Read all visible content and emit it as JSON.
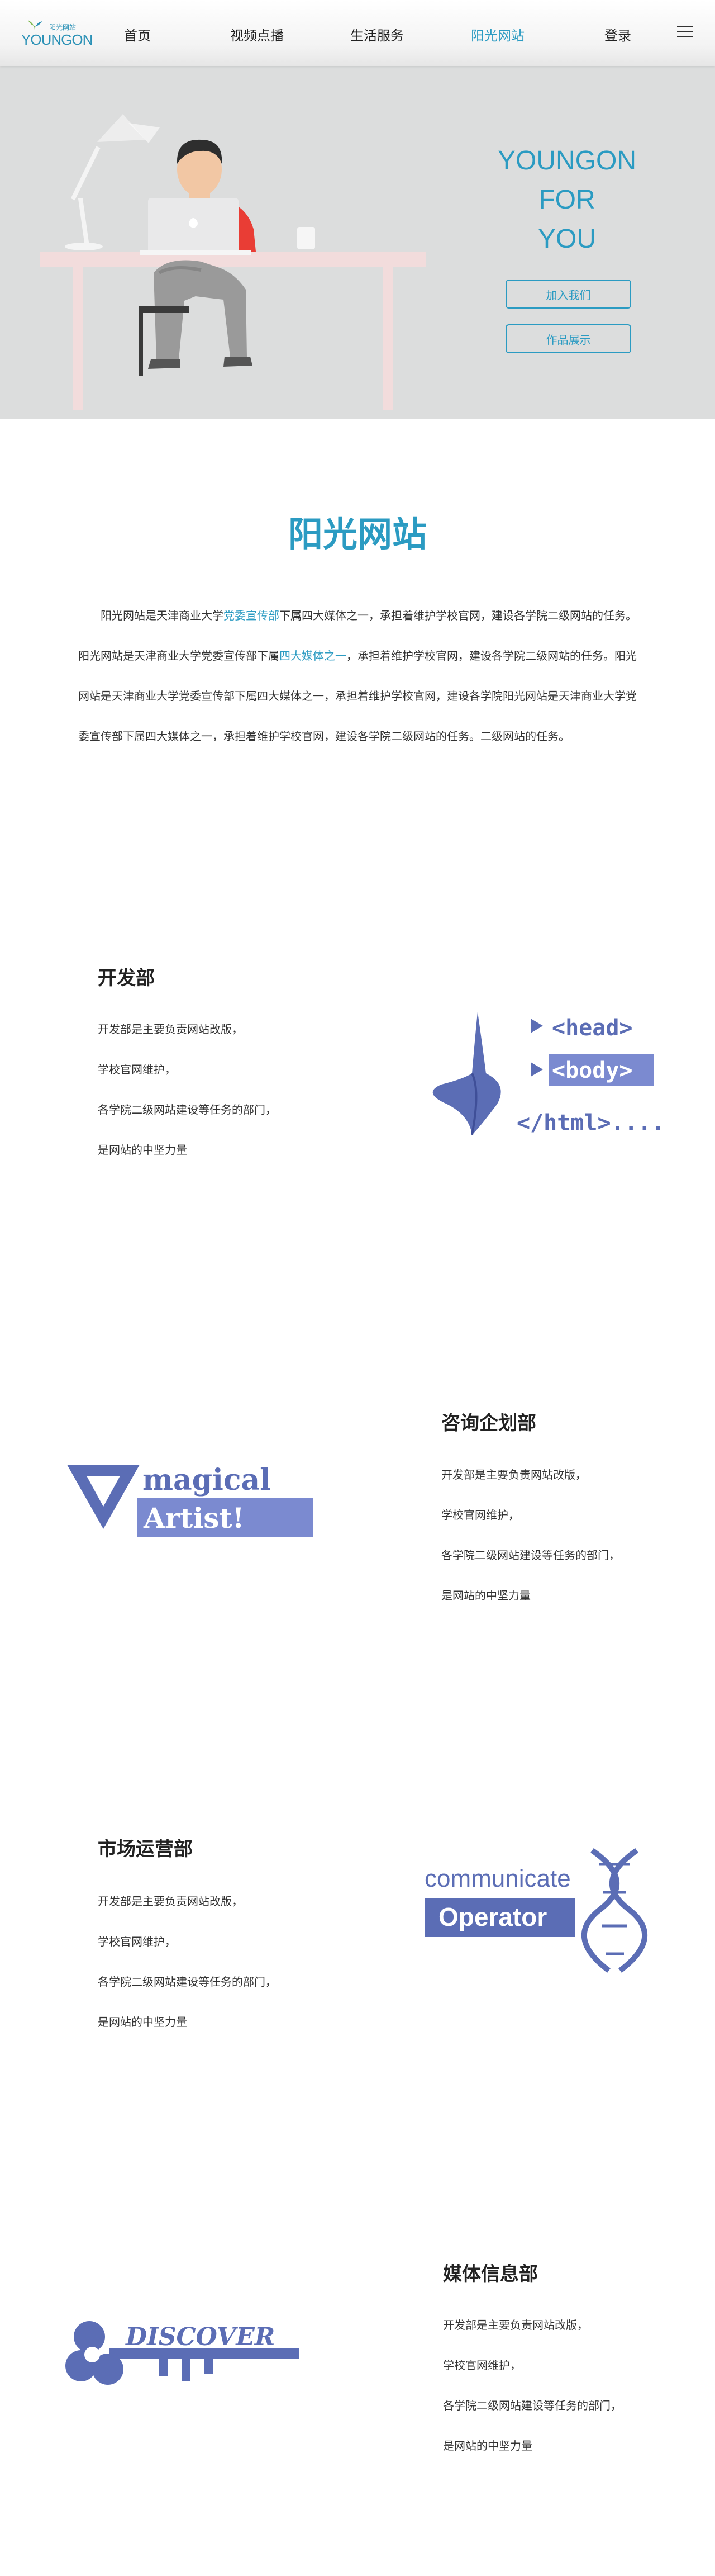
{
  "nav": {
    "logo_cn": "阳光网站",
    "logo_en": "YOUNGON",
    "items": [
      "首页",
      "视频点播",
      "生活服务",
      "阳光网站",
      "登录"
    ],
    "active_index": 3
  },
  "hero": {
    "title_lines": [
      "YOUNGON",
      "FOR",
      "YOU"
    ],
    "buttons": [
      "加入我们",
      "作品展示"
    ]
  },
  "intro": {
    "title": "阳光网站",
    "segments": [
      {
        "text": "阳光网站是天津商业大学",
        "hl": false
      },
      {
        "text": "党委宣传部",
        "hl": true
      },
      {
        "text": "下属四大媒体之一，承担着维护学校官网，建设各学院二级网站的任务。阳光网站是天津商业大学党委宣传部下属",
        "hl": false
      },
      {
        "text": "四大媒体之一",
        "hl": true
      },
      {
        "text": "，承担着维护学校官网，建设各学院二级网站的任务。阳光网站是天津商业大学党委宣传部下属四大媒体之一，承担着维护学校官网，建设各学院阳光网站是天津商业大学党委宣传部下属四大媒体之一，承担着维护学校官网，建设各学院二级网站的任务。二级网站的任务。",
        "hl": false
      }
    ]
  },
  "departments": [
    {
      "name": "开发部",
      "lines": [
        "开发部是主要负责网站改版，",
        "学校官网维护，",
        "各学院二级网站建设等任务的部门，",
        "是网站的中坚力量"
      ],
      "art_lines": [
        "<head>",
        "<body>",
        "</html>...."
      ]
    },
    {
      "name": "咨询企划部",
      "lines": [
        "开发部是主要负责网站改版，",
        "学校官网维护，",
        "各学院二级网站建设等任务的部门，",
        "是网站的中坚力量"
      ],
      "art_lines": [
        "magical",
        "Artist!"
      ]
    },
    {
      "name": "市场运营部",
      "lines": [
        "开发部是主要负责网站改版，",
        "学校官网维护，",
        "各学院二级网站建设等任务的部门，",
        "是网站的中坚力量"
      ],
      "art_lines": [
        "communicate",
        "Operator"
      ]
    },
    {
      "name": "媒体信息部",
      "lines": [
        "开发部是主要负责网站改版，",
        "学校官网维护，",
        "各学院二级网站建设等任务的部门，",
        "是网站的中坚力量"
      ],
      "art_lines": [
        "DISCOVER"
      ]
    }
  ],
  "colors": {
    "accent": "#2b9bc2",
    "illustration": "#5b6db5"
  }
}
